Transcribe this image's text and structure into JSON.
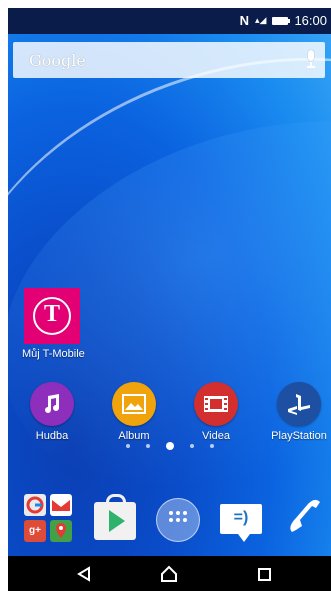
{
  "status_bar": {
    "nfc_icon": "N",
    "signal_icon": "signal-icon",
    "battery_icon": "battery-icon",
    "time": "16:00"
  },
  "search": {
    "label": "Google",
    "mic_icon": "microphone-icon"
  },
  "shortcuts": [
    {
      "label": "Můj T-Mobile",
      "icon": "t-mobile-icon",
      "color": "#e20074"
    }
  ],
  "apps_row": [
    {
      "label": "Hudba",
      "icon": "music-note-icon",
      "color": "#8e2ebd"
    },
    {
      "label": "Album",
      "icon": "picture-icon",
      "color": "#f0a30a"
    },
    {
      "label": "Videa",
      "icon": "film-icon",
      "color": "#d32f2f"
    },
    {
      "label": "PlayStation",
      "icon": "playstation-icon",
      "color": "#1d4fa3"
    }
  ],
  "page_indicator": {
    "pages": 5,
    "active": 3
  },
  "dock": [
    {
      "name": "google-apps-folder",
      "icon": "folder-icon"
    },
    {
      "name": "play-store",
      "icon": "play-store-icon"
    },
    {
      "name": "app-drawer",
      "icon": "apps-grid-icon"
    },
    {
      "name": "messaging",
      "icon": "message-icon"
    },
    {
      "name": "phone",
      "icon": "phone-icon"
    }
  ],
  "nav": {
    "back_icon": "back-icon",
    "home_icon": "home-icon",
    "recent_icon": "recent-apps-icon"
  }
}
